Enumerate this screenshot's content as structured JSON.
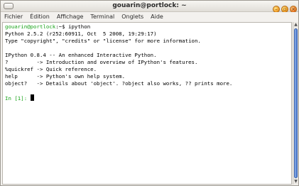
{
  "window": {
    "title": "gouarin@portlock: ~",
    "buttons": {
      "minimize_glyph": "–",
      "maximize_glyph": "▫",
      "close_glyph": "×"
    }
  },
  "menubar": {
    "items": [
      {
        "label": "Fichier"
      },
      {
        "label": "Édition"
      },
      {
        "label": "Affichage"
      },
      {
        "label": "Terminal"
      },
      {
        "label": "Onglets"
      },
      {
        "label": "Aide"
      }
    ]
  },
  "terminal": {
    "prompt_user": "gouarin@portlock",
    "prompt_rest": ":~$ ipython",
    "lines": [
      "Python 2.5.2 (r252:60911, Oct  5 2008, 19:29:17)",
      "Type \"copyright\", \"credits\" or \"license\" for more information.",
      "",
      "IPython 0.8.4 -- An enhanced Interactive Python.",
      "?         -> Introduction and overview of IPython's features.",
      "%quickref -> Quick reference.",
      "help      -> Python's own help system.",
      "object?   -> Details about 'object'. ?object also works, ?? prints more."
    ],
    "input_prompt": "In [1]: "
  },
  "colors": {
    "prompt_user": "#19a319",
    "input_prompt": "#1f3fd1",
    "scroll_thumb": "#4a79cf"
  },
  "scrollbar": {
    "up_glyph": "▲",
    "down_glyph": "▼"
  }
}
